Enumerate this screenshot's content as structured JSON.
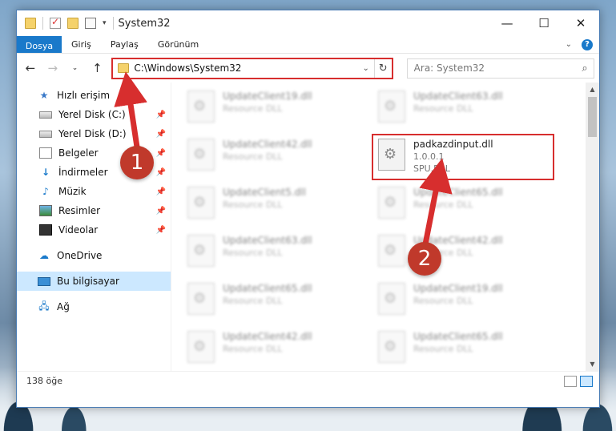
{
  "window": {
    "title": "System32"
  },
  "ribbon": {
    "tabs": [
      "Dosya",
      "Giriş",
      "Paylaş",
      "Görünüm"
    ]
  },
  "address": {
    "path": "C:\\Windows\\System32"
  },
  "search": {
    "placeholder": "Ara: System32"
  },
  "sidebar": {
    "quick_access": "Hızlı erişim",
    "items": [
      {
        "label": "Yerel Disk (C:)",
        "icon": "drive-icon",
        "pinned": true
      },
      {
        "label": "Yerel Disk (D:)",
        "icon": "drive-icon",
        "pinned": true
      },
      {
        "label": "Belgeler",
        "icon": "documents-icon",
        "pinned": true
      },
      {
        "label": "İndirmeler",
        "icon": "download-icon",
        "pinned": true
      },
      {
        "label": "Müzik",
        "icon": "music-icon",
        "pinned": true
      },
      {
        "label": "Resimler",
        "icon": "pictures-icon",
        "pinned": true
      },
      {
        "label": "Videolar",
        "icon": "videos-icon",
        "pinned": true
      }
    ],
    "onedrive": "OneDrive",
    "this_pc": "Bu bilgisayar",
    "network": "Ağ"
  },
  "files": [
    {
      "name": "UpdateClient19.dll",
      "desc": "Resource DLL",
      "blurred": true
    },
    {
      "name": "UpdateClient63.dll",
      "desc": "Resource DLL",
      "blurred": true
    },
    {
      "name": "UpdateClient42.dll",
      "desc": "Resource DLL",
      "blurred": true
    },
    {
      "name": "padkazdinput.dll",
      "version": "1.0.0.1",
      "desc": "SPU.DLL",
      "blurred": false,
      "highlighted": true
    },
    {
      "name": "UpdateClient5.dll",
      "desc": "Resource DLL",
      "blurred": true
    },
    {
      "name": "UpdateClient65.dll",
      "desc": "Resource DLL",
      "blurred": true
    },
    {
      "name": "UpdateClient63.dll",
      "desc": "Resource DLL",
      "blurred": true
    },
    {
      "name": "UpdateClient42.dll",
      "desc": "Resource DLL",
      "blurred": true
    },
    {
      "name": "UpdateClient65.dll",
      "desc": "Resource DLL",
      "blurred": true
    },
    {
      "name": "UpdateClient19.dll",
      "desc": "Resource DLL",
      "blurred": true
    },
    {
      "name": "UpdateClient42.dll",
      "desc": "Resource DLL",
      "blurred": true
    },
    {
      "name": "UpdateClient65.dll",
      "desc": "Resource DLL",
      "blurred": true
    }
  ],
  "status": {
    "count": "138 öğe"
  },
  "annotations": [
    {
      "number": "1",
      "color": "#c0392b"
    },
    {
      "number": "2",
      "color": "#c0392b"
    }
  ],
  "colors": {
    "accent": "#1979ca",
    "highlight": "#d72e2e"
  }
}
